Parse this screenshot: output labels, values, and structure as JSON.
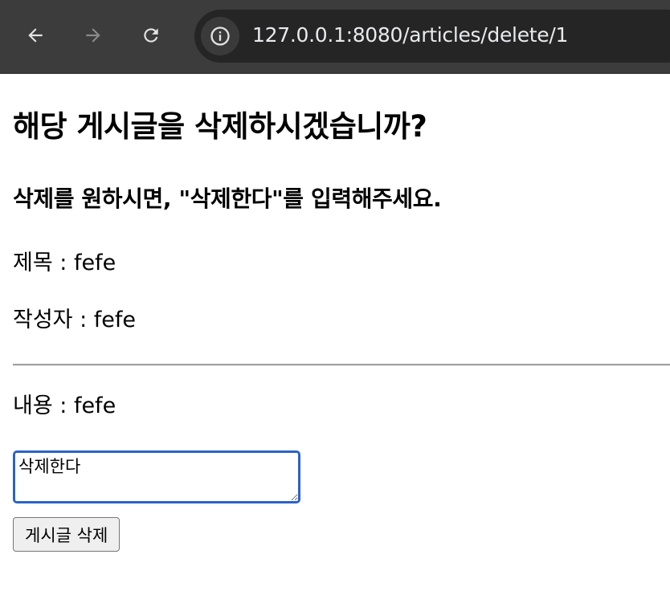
{
  "browser": {
    "url": "127.0.0.1:8080/articles/delete/1",
    "back_icon": "arrow-left-icon",
    "forward_icon": "arrow-right-icon",
    "reload_icon": "reload-icon",
    "site_info_icon": "info-icon"
  },
  "page": {
    "heading": "해당 게시글을 삭제하시겠습니까?",
    "subheading": "삭제를 원하시면, \"삭제한다\"를 입력해주세요.",
    "title_line": "제목 : fefe",
    "author_line": "작성자 : fefe",
    "content_line": "내용 : fefe"
  },
  "form": {
    "confirm_value": "삭제한다",
    "submit_label": "게시글 삭제"
  },
  "colors": {
    "toolbar": "#3c3c3c",
    "omnibox": "#252525",
    "focus_ring": "#2a63c9"
  }
}
